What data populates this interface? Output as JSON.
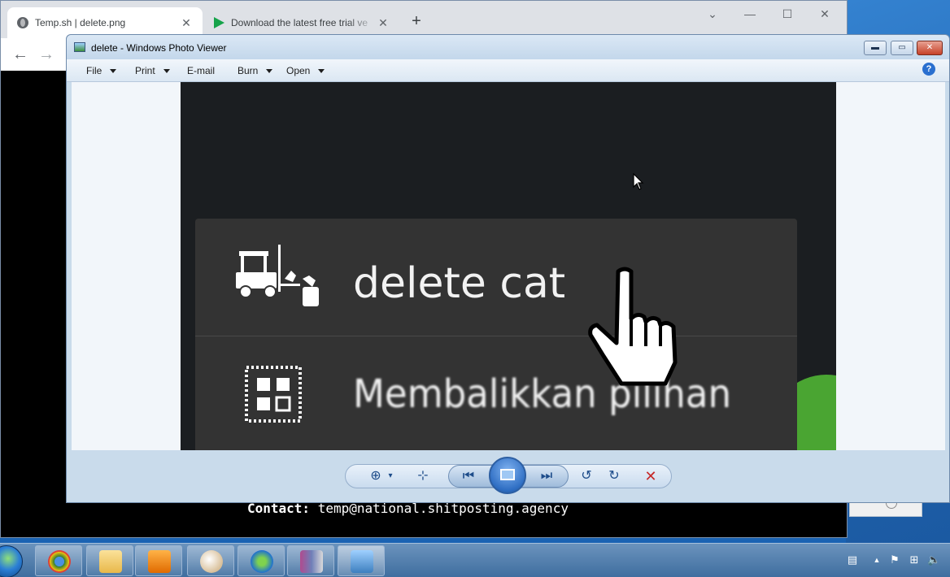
{
  "browser": {
    "tabs": [
      {
        "label": "Temp.sh | delete.png",
        "icon": "globe-icon",
        "close": "✕"
      },
      {
        "label": "Download the latest free trial ve",
        "icon": "play-icon",
        "close": "✕"
      }
    ],
    "new_tab": "+",
    "window_controls": {
      "dropdown": "⌄",
      "minimize": "—",
      "maximize": "☐",
      "close": "✕"
    },
    "nav": {
      "back": "←",
      "forward": "→"
    },
    "page": {
      "contact_label": "Contact:",
      "contact_value": "temp@national.shitposting.agency"
    }
  },
  "viewer": {
    "title": "delete - Windows Photo Viewer",
    "controls": {
      "minimize": "▬",
      "maximize": "▭",
      "close": "✕"
    },
    "menu": [
      {
        "label": "File",
        "dropdown": true
      },
      {
        "label": "Print",
        "dropdown": true
      },
      {
        "label": "E-mail",
        "dropdown": false
      },
      {
        "label": "Burn",
        "dropdown": true
      },
      {
        "label": "Open",
        "dropdown": true
      }
    ],
    "help": "?",
    "image": {
      "item_1": "delete cat",
      "item_2": "Membalikkan pilihan"
    },
    "toolbar_icons": [
      "zoom-icon",
      "fit-window-icon",
      "previous-icon",
      "slideshow-icon",
      "next-icon",
      "rotate-left-icon",
      "rotate-right-icon",
      "delete-icon"
    ],
    "toolbar_glyphs": {
      "zoom": "⊕",
      "zoom_caret": "▾",
      "fit": "⊹",
      "previous": "⏮",
      "next": "⏭",
      "rotate_left": "↺",
      "rotate_right": "↻",
      "delete": "✕"
    }
  },
  "taskbar": {
    "apps": [
      "chrome",
      "file-explorer",
      "media-player",
      "paint",
      "download-manager",
      "archive-tool",
      "photo-viewer"
    ],
    "tray_glyphs": {
      "keyboard": "▤",
      "show_hidden": "▲",
      "flag": "⚑",
      "network": "⊞",
      "volume": "🔈"
    }
  }
}
